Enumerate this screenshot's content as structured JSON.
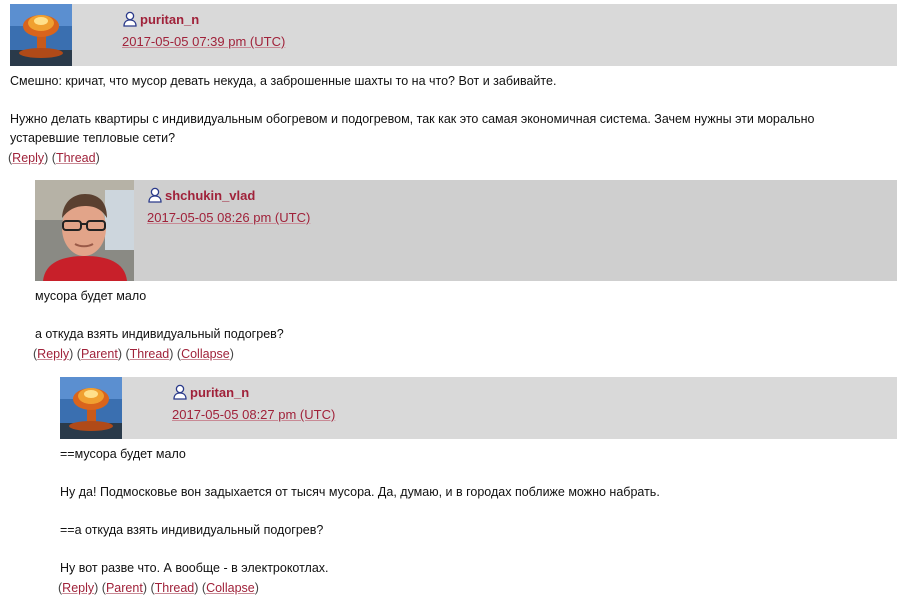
{
  "comments": [
    {
      "username": "puritan_n",
      "date": "2017-05-05 07:39 pm (UTC)",
      "paragraphs": [
        "Смешно: кричат, что мусор девать некуда, а заброшенные шахты то на что? Вот и забивайте.",
        "Нужно делать квартиры с индивидуальным обогревом и подогревом, так как это самая экономичная система. Зачем нужны эти морально устаревшие тепловые сети?"
      ],
      "links": [
        "Reply",
        "Thread"
      ]
    },
    {
      "username": "shchukin_vlad",
      "date": "2017-05-05 08:26 pm (UTC)",
      "paragraphs": [
        "мусора будет мало",
        "а откуда взять индивидуальный подогрев?"
      ],
      "links": [
        "Reply",
        "Parent",
        "Thread",
        "Collapse"
      ]
    },
    {
      "username": "puritan_n",
      "date": "2017-05-05 08:27 pm (UTC)",
      "paragraphs": [
        "==мусора будет мало",
        "Ну да! Подмосковье вон задыхается от тысяч мусора. Да, думаю, и в городах поближе можно набрать.",
        "==а откуда взять индивидуальный подогрев?",
        "Ну вот разве что. А вообще - в электрокотлах."
      ],
      "links": [
        "Reply",
        "Parent",
        "Thread",
        "Collapse"
      ]
    }
  ],
  "icons": {
    "user": "user-profile-icon",
    "avatar_puritan": "mushroom-cloud-avatar",
    "avatar_shchukin": "man-with-glasses-avatar"
  },
  "colors": {
    "link": "#a0223a",
    "header_bg": "#d9d9d9"
  }
}
